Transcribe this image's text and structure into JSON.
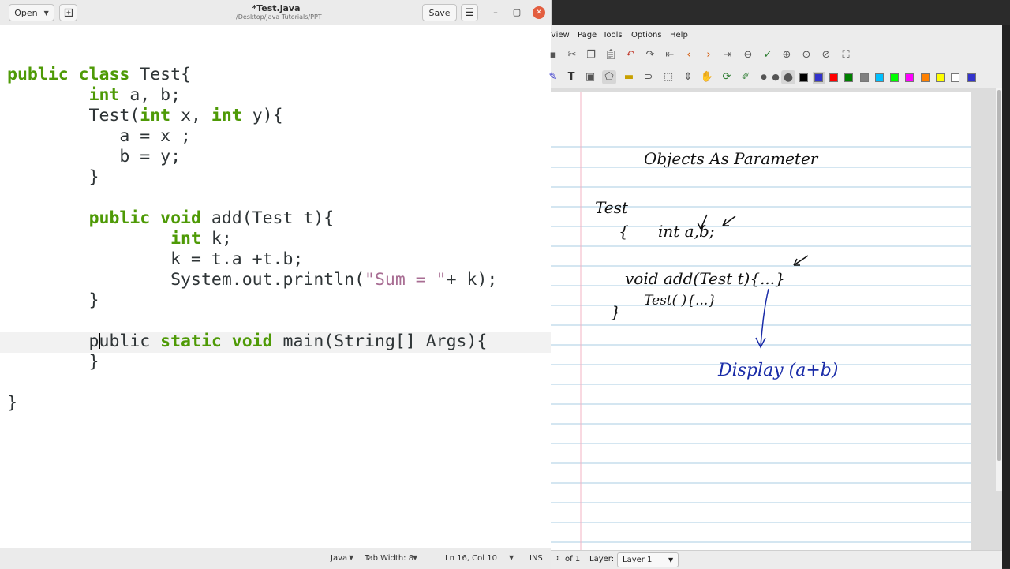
{
  "gedit": {
    "open_label": "Open",
    "save_label": "Save",
    "title": "*Test.java",
    "subtitle": "~/Desktop/Java Tutorials/PPT",
    "status": {
      "language": "Java",
      "tab_width": "Tab Width: 8",
      "position": "Ln 16, Col 10",
      "mode": "INS"
    }
  },
  "xournal": {
    "menu": {
      "view": "View",
      "page": "Page",
      "tools": "Tools",
      "options": "Options",
      "help": "Help"
    },
    "status": {
      "of_pages": "of 1",
      "layer_label": "Layer:",
      "layer_value": "Layer 1"
    },
    "colors": [
      "#000000",
      "#3333cc",
      "#ff0000",
      "#008000",
      "#808080",
      "#00c0ff",
      "#00ff00",
      "#ff00ff",
      "#ff8000",
      "#ffff00",
      "#ffffff",
      "#3333cc"
    ],
    "notes": {
      "title": "Objects As Parameter",
      "class_name": "Test",
      "open_brace": "{",
      "fields": "int a,b;",
      "method": "void add(Test t){...}",
      "constructor": "Test( ){...}",
      "close_brace": "}",
      "result": "Display (a+b)"
    }
  }
}
